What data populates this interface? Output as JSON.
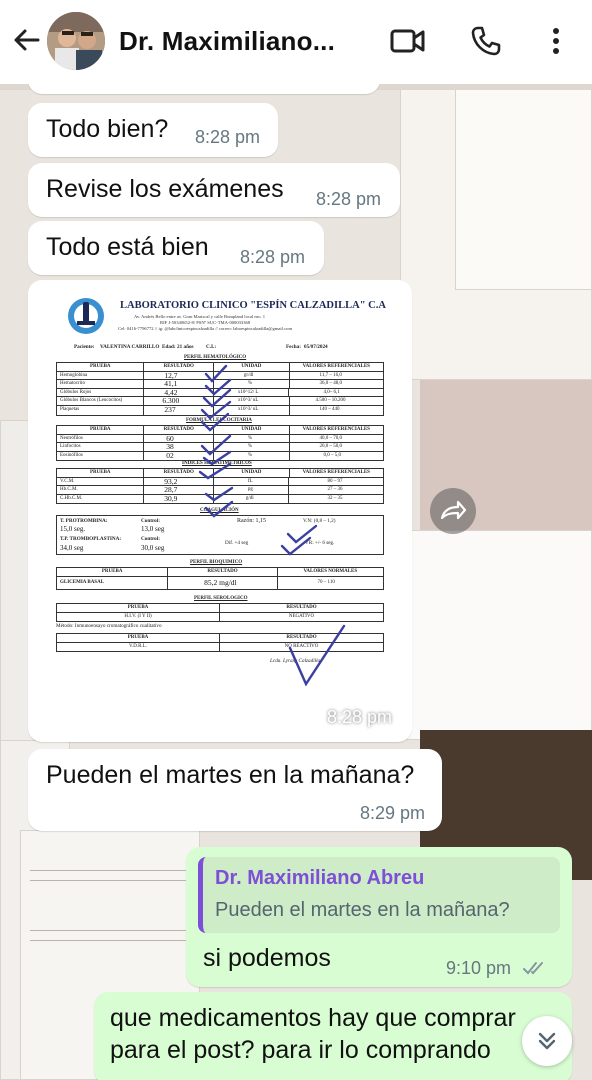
{
  "header": {
    "contact_name": "Dr. Maximiliano...",
    "back_icon": "arrow-left-icon",
    "video_icon": "video-camera-icon",
    "call_icon": "phone-icon",
    "menu_icon": "more-vertical-icon"
  },
  "messages": [
    {
      "text": "Todo bien?",
      "time": "8:28 pm",
      "direction": "incoming"
    },
    {
      "text": "Revise los exámenes",
      "time": "8:28 pm",
      "direction": "incoming"
    },
    {
      "text": "Todo está bien",
      "time": "8:28 pm",
      "direction": "incoming"
    },
    {
      "type": "image",
      "time": "8:28 pm",
      "direction": "incoming"
    },
    {
      "text": "Pueden el martes en la mañana?",
      "time": "8:29 pm",
      "direction": "incoming"
    },
    {
      "text": "si podemos",
      "time": "9:10 pm",
      "direction": "outgoing",
      "status": "read",
      "quote": {
        "author": "Dr. Maximiliano Abreu",
        "text": "Pueden el martes en la mañana?"
      }
    },
    {
      "text_line1": "que medicamentos hay que comprar",
      "text_line2": "para el post? para ir lo comprando",
      "direction": "outgoing"
    }
  ],
  "document": {
    "lab_name": "LABORATORIO CLINICO \"ESPÍN CALZADILLA\" C.A",
    "address1": "Av. Andrés Bello entre av. Gran Mariscal y calle Bompland local nro. 1",
    "address2": "RIF J-50340652-8/ PSNº SUC-TMA-000033368",
    "contact": "Cel: 0416-7796772 // ig: @labclinicoespincalzadilla // correo: laboespincalzadilla@gmail.com",
    "patient_label": "Paciente:",
    "patient_name": "VALENTINA CARRILLO",
    "age_label": "Edad:",
    "age": "21 años",
    "ci_label": "C.I.:",
    "date_label": "Fecha:",
    "date": "05/07/2024",
    "section_hematologico": "PERFIL HEMATOLÓGICO",
    "col_prueba": "PRUEBA",
    "col_resultado": "RESULTADO",
    "col_unidad": "UNIDAD",
    "col_ref": "VALORES REFERENCIALES",
    "col_normales": "VALORES NORMALES",
    "hemato_rows": [
      {
        "prueba": "Hemoglobina",
        "resultado": "12,7",
        "unidad": "gr/dl",
        "ref": "11,7 – 16,0"
      },
      {
        "prueba": "Hematocrito",
        "resultado": "41,1",
        "unidad": "%",
        "ref": "36,0 – 48,0"
      },
      {
        "prueba": "Glóbulos Rojos",
        "resultado": "4,42",
        "unidad": "x10^12/ L",
        "ref": "4,0– 6,1"
      },
      {
        "prueba": "Glóbulos Blancos (Leucocitos)",
        "resultado": "6.300",
        "unidad": "x10^3/ uL",
        "ref": "4.500 – 10.200"
      },
      {
        "prueba": "Plaquetas",
        "resultado": "237",
        "unidad": "x10^3/ uL",
        "ref": "140 – 440"
      }
    ],
    "section_leucocitaria": "FORMULA LEUCOCITARIA",
    "leuco_rows": [
      {
        "prueba": "Neutrófilos",
        "resultado": "60",
        "unidad": "%",
        "ref": "40,0 – 70,0"
      },
      {
        "prueba": "Linfocitos",
        "resultado": "38",
        "unidad": "%",
        "ref": "20,0 – 50,0"
      },
      {
        "prueba": "Eosinófilos",
        "resultado": "02",
        "unidad": "%",
        "ref": "0,0 – 5,0"
      }
    ],
    "section_indices": "INDICES HEMATIMETRICOS",
    "indices_rows": [
      {
        "prueba": "V.C.M.",
        "resultado": "93,2",
        "unidad": "fL",
        "ref": "80 – 97"
      },
      {
        "prueba": "Hb.C.M.",
        "resultado": "28,7",
        "unidad": "pg",
        "ref": "27 – 36"
      },
      {
        "prueba": "C.Hb.C.M.",
        "resultado": "30,9",
        "unidad": "g/dl",
        "ref": "32 – 35"
      }
    ],
    "section_coagulacion": "COAGULACIÓN",
    "pt_label": "T. PROTROMBINA:",
    "pt_value": "15,0 seg.",
    "pt_control_label": "Control:",
    "pt_control": "13,0 seg",
    "razon_label": "Razón: 1,15",
    "vn_label": "V.N: (0,8 – 1,2)",
    "ptt_label": "T.P. TROMBOPLASTINA:",
    "ptt_value": "34,0 seg",
    "ptt_control_label": "Control:",
    "ptt_control": "30,0 seg",
    "dif_label": "Dif. +4 seg",
    "vr_label": "VR: +/- 6 seg.",
    "section_bioquimico": "PERFIL BIOQUIMICO",
    "glucemia_label": "GLICEMIA BASAL",
    "glucemia_value": "85,2 mg/dl",
    "glucemia_ref": "70 – 110",
    "section_serologico": "PERFIL SEROLOGICO",
    "hiv_label": "H.I.V. (I Y II)",
    "hiv_result": "NEGATIVO",
    "method": "Método: Inmunoensayo cromatográfico cualitativo",
    "vdrl_label": "V.D.R.L.",
    "vdrl_result": "NO REACTIVO",
    "signature": "Lcda. Lyraxy Calzadilla",
    "col_resultado_short": "RESULTADO"
  },
  "colors": {
    "incoming_bubble": "#ffffff",
    "outgoing_bubble": "#d9fdd3",
    "quote_accent": "#7c4fd6",
    "time_color": "#667781",
    "read_ticks": "#8696a0"
  }
}
